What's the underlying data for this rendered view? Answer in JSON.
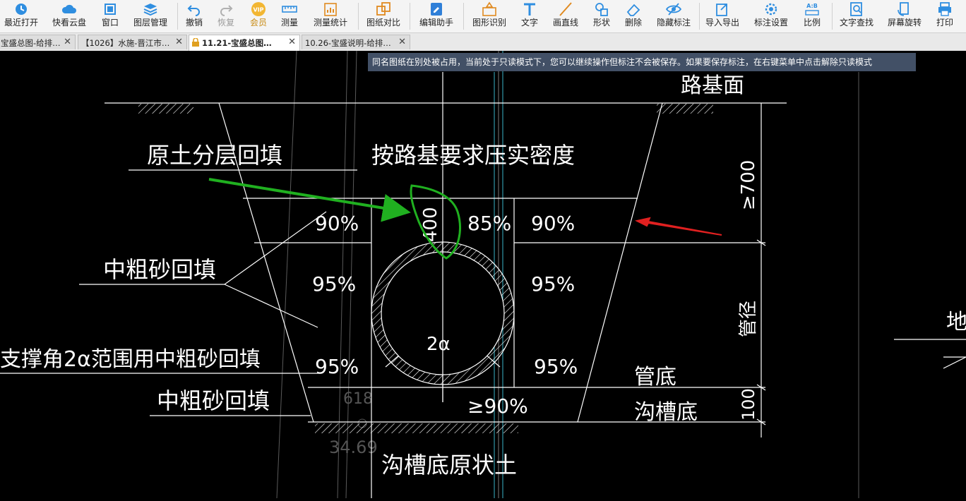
{
  "toolbar": {
    "recent_open": "最近打开",
    "cloud_quick": "快看云盘",
    "window": "窗口",
    "layer_manage": "图层管理",
    "undo": "撤销",
    "redo": "恢复",
    "vip": "会员",
    "vip_badge": "VIP",
    "measure": "测量",
    "measure_stats": "测量统计",
    "drawing_compare": "图纸对比",
    "edit_assistant": "编辑助手",
    "shape_recognize": "图形识别",
    "text": "文字",
    "draw_line": "画直线",
    "shape": "形状",
    "delete": "删除",
    "hide_marks": "隐藏标注",
    "import_export": "导入导出",
    "mark_settings": "标注设置",
    "scale": "比例",
    "scale_badge": "A:B",
    "text_search": "文字查找",
    "screen_rotate": "屏幕旋转",
    "print": "打印"
  },
  "tabs": [
    {
      "label": "宝盛总图-给排…",
      "close": "✕"
    },
    {
      "label": "【1026】水施-晋江市…",
      "close": "✕"
    },
    {
      "label": "11.21-宝盛总图…",
      "close": "✕"
    },
    {
      "label": "10.26-宝盛说明-给排…",
      "close": "✕"
    }
  ],
  "notice": "同名图纸在别处被占用，当前处于只读模式下，您可以继续操作但标注不会被保存。如果要保存标注，在右键菜单中点击解除只读模式",
  "drawing": {
    "road_base_surface": "路基面",
    "original_soil_backfill": "原土分层回填",
    "compaction_note": "按路基要求压实密度",
    "medium_coarse_sand_backfill_1": "中粗砂回填",
    "support_angle_note": "支撑角2α范围用中粗砂回填",
    "medium_coarse_sand_backfill_2": "中粗砂回填",
    "trench_bottom_original_soil": "沟槽底原状土",
    "pipe_bottom": "管底",
    "trench_bottom": "沟槽底",
    "pipe_diameter": "管径",
    "ground_partial": "地面",
    "pct_90_left": "90%",
    "pct_85": "85%",
    "pct_90_right": "90%",
    "pct_95_left_mid": "95%",
    "pct_95_right_mid": "95%",
    "pct_95_left_low": "95%",
    "pct_95_right_low": "95%",
    "pct_ge90": "≥90%",
    "center_2a": "2α",
    "dim_400": "400",
    "dim_700": "≥700",
    "dim_100": "100",
    "faint_label_1": "618",
    "faint_label_2": "34.69"
  },
  "colors": {
    "cad_line": "#ffffff",
    "annotation_green": "#20b020",
    "annotation_red": "#e02020",
    "notice_bg": "#425066"
  }
}
